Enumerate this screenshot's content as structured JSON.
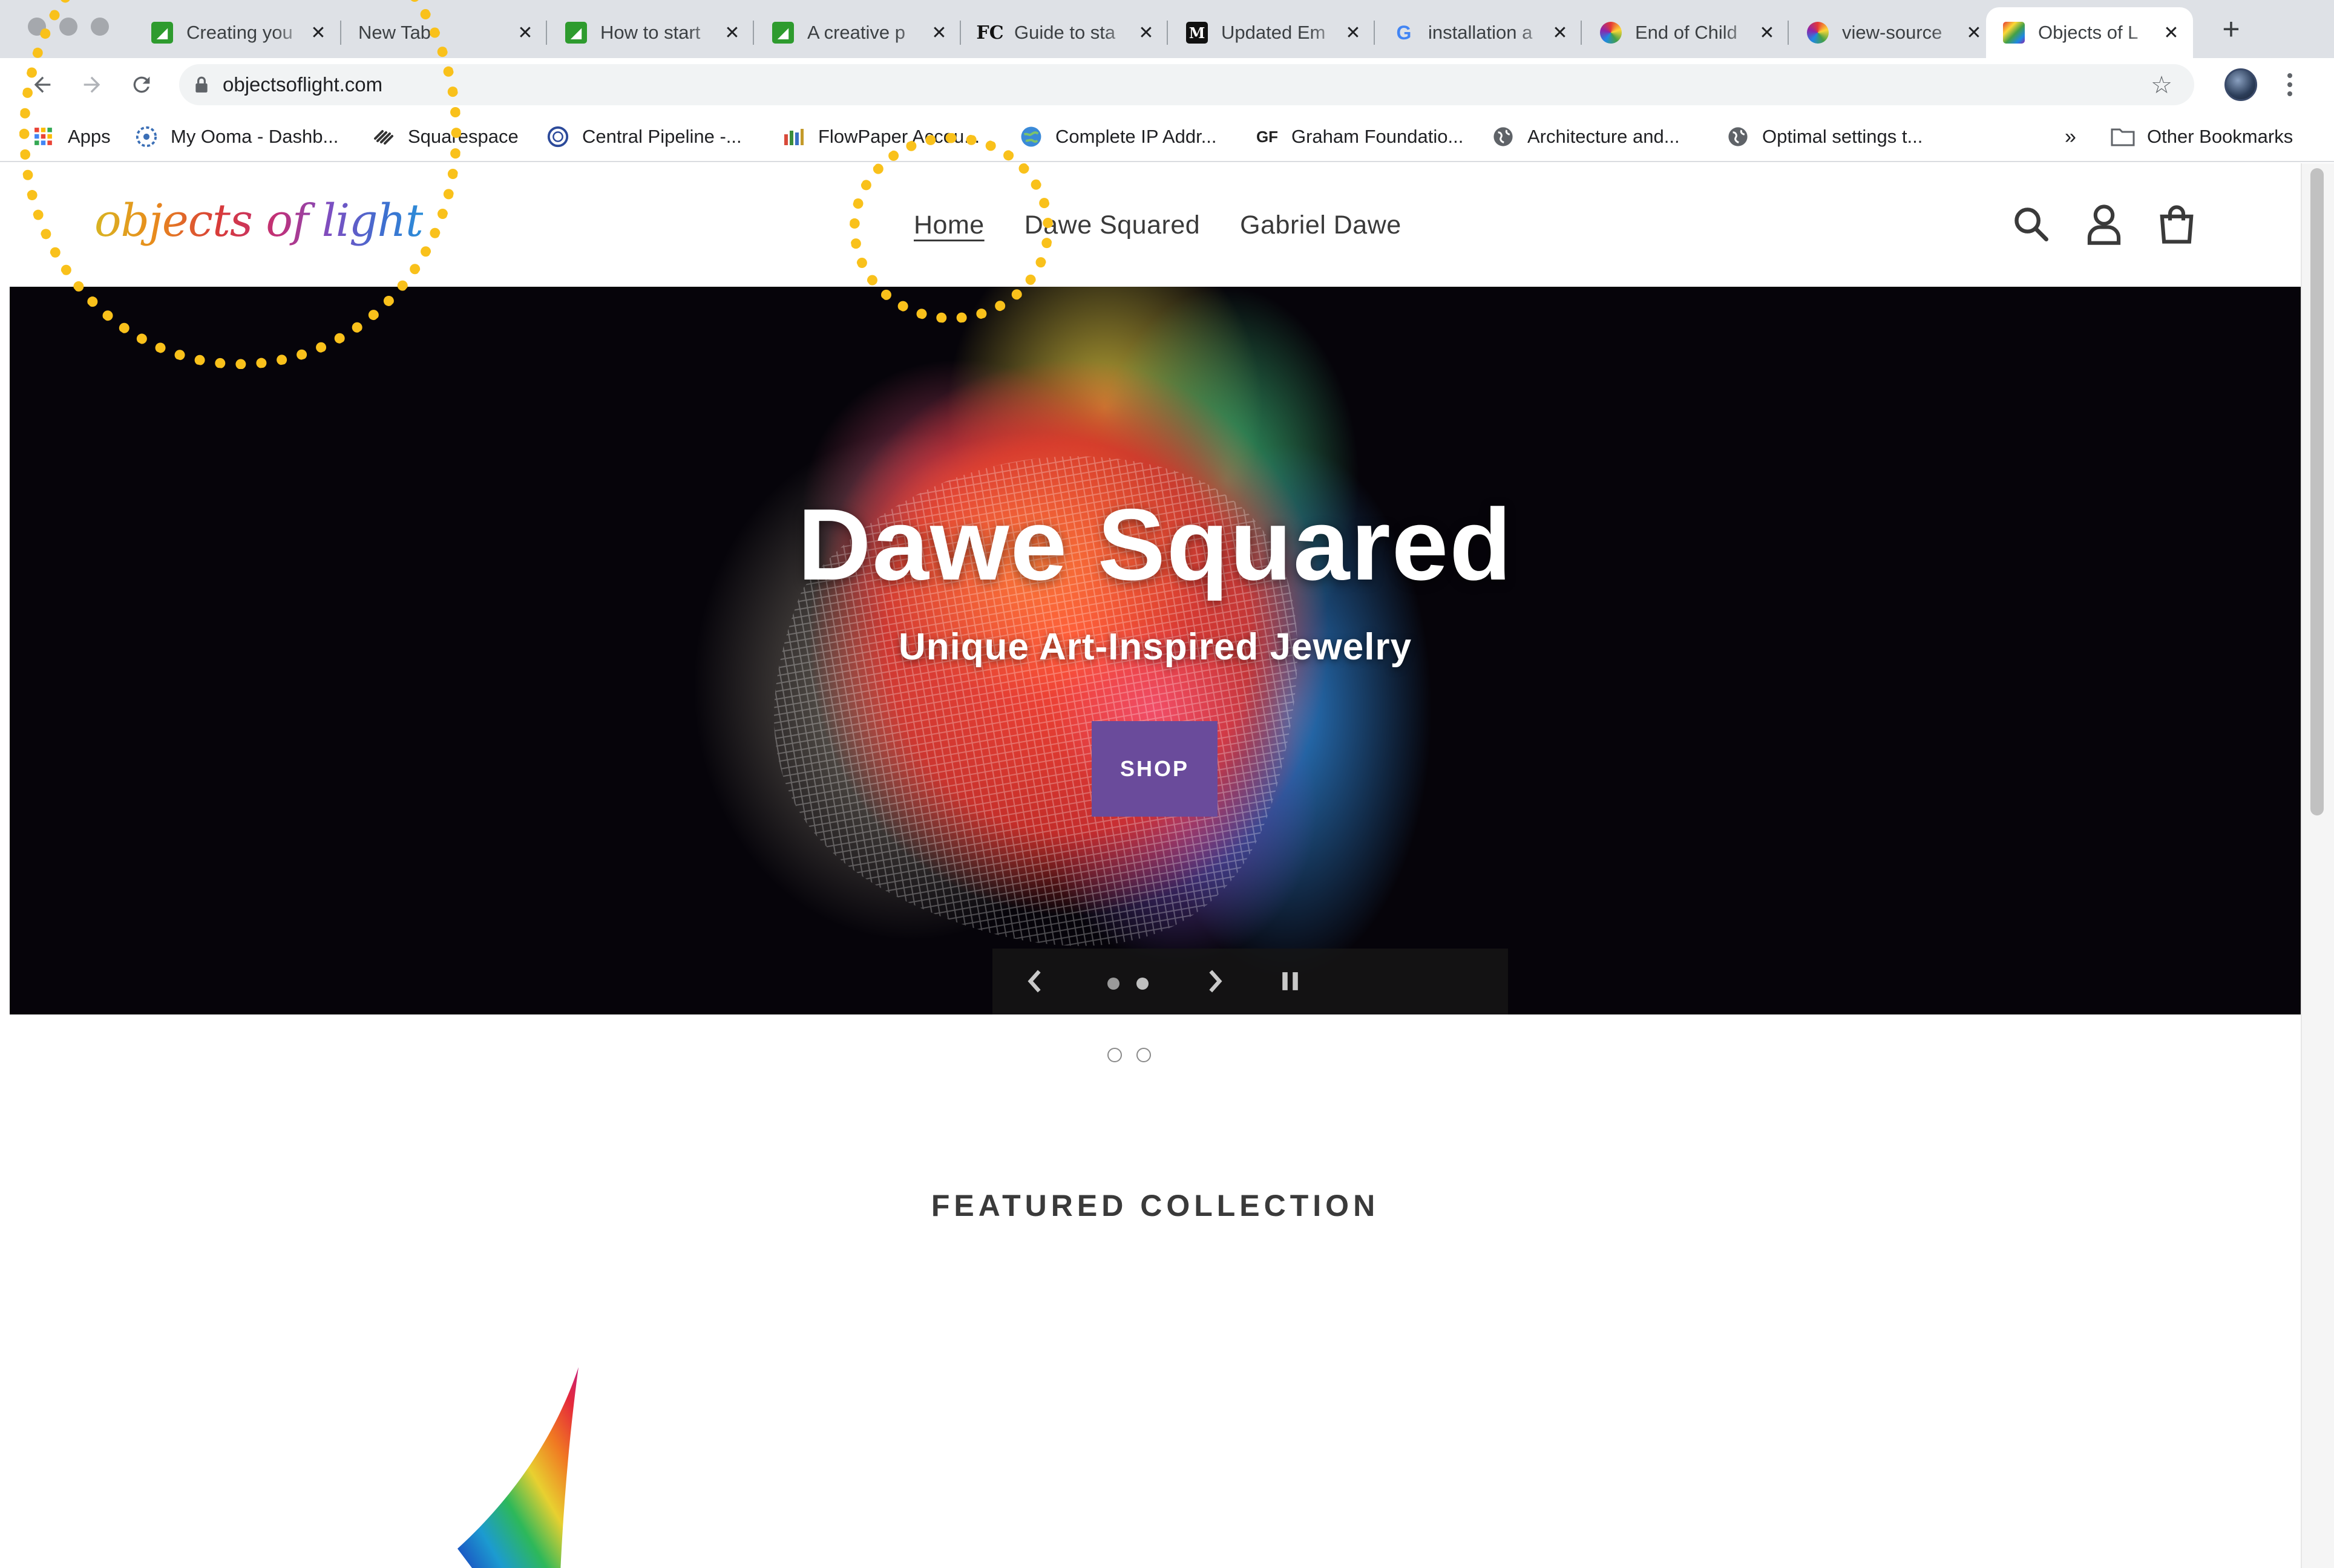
{
  "browser": {
    "tabs": [
      {
        "title": "Creating you",
        "icon": "green-site-icon"
      },
      {
        "title": "New Tab",
        "icon": "none"
      },
      {
        "title": "How to start",
        "icon": "green-site-icon"
      },
      {
        "title": "A creative p",
        "icon": "green-site-icon"
      },
      {
        "title": "Guide to sta",
        "icon": "fc-icon"
      },
      {
        "title": "Updated Em",
        "icon": "medium-icon"
      },
      {
        "title": "installation a",
        "icon": "google-icon"
      },
      {
        "title": "End of Child",
        "icon": "color-wheel-icon"
      },
      {
        "title": "view-source",
        "icon": "color-wheel-icon"
      },
      {
        "title": "Objects of L",
        "icon": "objects-of-light-icon",
        "active": true
      }
    ],
    "tab_icon_text": {
      "fc": "FC",
      "medium": "M",
      "google": "G"
    },
    "new_tab_symbol": "+",
    "close_symbol": "✕",
    "url": "objectsoflight.com",
    "bookmarks": [
      {
        "label": "Apps",
        "icon": "apps-grid-icon"
      },
      {
        "label": "My Ooma - Dashb...",
        "icon": "ooma-icon"
      },
      {
        "label": "Squarespace",
        "icon": "squarespace-icon"
      },
      {
        "label": "Central Pipeline -...",
        "icon": "pipeline-icon"
      },
      {
        "label": "FlowPaper Accou...",
        "icon": "flowpaper-icon"
      },
      {
        "label": "Complete IP Addr...",
        "icon": "globe-icon"
      },
      {
        "label": "Graham Foundatio...",
        "icon": "gf-icon",
        "icon_text": "GF"
      },
      {
        "label": "Architecture and...",
        "icon": "world-icon"
      },
      {
        "label": "Optimal settings t...",
        "icon": "world-icon"
      }
    ],
    "bookmarks_overflow": "»",
    "other_bookmarks": "Other Bookmarks"
  },
  "site": {
    "logo_text": "objects of light",
    "nav": [
      {
        "label": "Home",
        "current": true
      },
      {
        "label": "Dawe Squared"
      },
      {
        "label": "Gabriel Dawe"
      }
    ],
    "hero": {
      "title": "Dawe Squared",
      "subtitle": "Unique Art-Inspired Jewelry",
      "button": "SHOP",
      "slide_count": 2,
      "active_slide": 1
    },
    "featured_heading": "FEATURED COLLECTION"
  },
  "colors": {
    "annotation": "#f9c11b",
    "shop_button": "#6a4b9b",
    "hero_background": "#06040a"
  }
}
